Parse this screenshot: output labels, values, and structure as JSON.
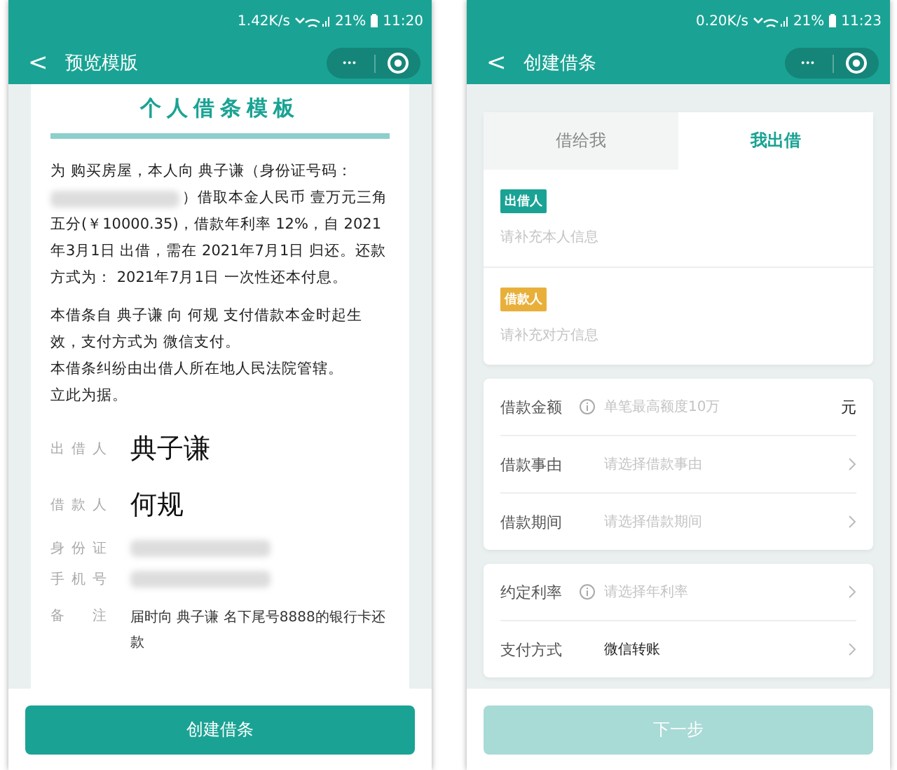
{
  "preview_screen": {
    "status_bar": {
      "speed": "1.42K/s",
      "battery": "21%",
      "time": "11:20"
    },
    "nav": {
      "back": "<",
      "title": "预览模版",
      "more": "•••"
    },
    "document": {
      "title": "个人借条模板",
      "paragraph_1_before": "为 购买房屋，本人向 典子谦（身份证号码：",
      "paragraph_1_line_2": "）借取本金人民币 壹万元三角",
      "paragraph_1_rest": "五分(￥10000.35)，借款年利率 12%，自 2021年3月1日 出借，需在 2021年7月1日 归还。还款方式为： 2021年7月1日 一次性还本付息。",
      "paragraph_2": [
        "本借条自 典子谦 向 何规 支付借款本金时起生效，支付方式为 微信支付。",
        "本借条纠纷由出借人所在地人民法院管辖。",
        "立此为据。"
      ],
      "signature_rows": [
        {
          "kind": "signature",
          "label": "出 借 人",
          "value": "典子谦"
        },
        {
          "kind": "signature",
          "label": "借 款 人",
          "value": "何规"
        },
        {
          "kind": "redacted",
          "label": "身 份 证"
        },
        {
          "kind": "redacted",
          "label": "手 机 号"
        },
        {
          "kind": "text",
          "label": "备 注",
          "value": "届时向 典子谦 名下尾号8888的银行卡还款"
        }
      ]
    },
    "button": {
      "label": "创建借条",
      "disabled": false
    }
  },
  "create_screen": {
    "status_bar": {
      "speed": "0.20K/s",
      "battery": "21%",
      "time": "11:23"
    },
    "nav": {
      "back": "<",
      "title": "创建借条",
      "more": "•••"
    },
    "tabs": [
      {
        "label": "借给我",
        "selected": false
      },
      {
        "label": "我出借",
        "selected": true
      }
    ],
    "parties": [
      {
        "badge": "出借人",
        "color": "#1aa394",
        "placeholder": "请补充本人信息"
      },
      {
        "badge": "借款人",
        "color": "#e8b03a",
        "placeholder": "请补充对方信息"
      }
    ],
    "groups": [
      [
        {
          "kind": "input",
          "label": "借款金额",
          "info": true,
          "placeholder": "单笔最高额度10万",
          "unit": "元"
        },
        {
          "kind": "select",
          "label": "借款事由",
          "info": false,
          "placeholder": "请选择借款事由"
        },
        {
          "kind": "select",
          "label": "借款期间",
          "info": false,
          "placeholder": "请选择借款期间"
        }
      ],
      [
        {
          "kind": "select",
          "label": "约定利率",
          "info": true,
          "placeholder": "请选择年利率"
        },
        {
          "kind": "select",
          "label": "支付方式",
          "info": false,
          "value": "微信转账"
        }
      ]
    ],
    "button": {
      "label": "下一步",
      "disabled": true
    }
  }
}
